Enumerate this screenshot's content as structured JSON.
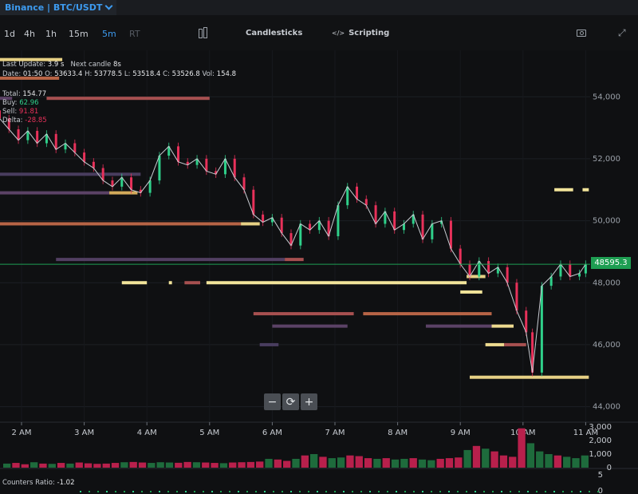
{
  "header": {
    "title": "Binance | BTC/USDT"
  },
  "toolbar": {
    "timeframes": [
      "1d",
      "4h",
      "1h",
      "15m",
      "5m",
      "RT"
    ],
    "active_timeframe": "5m",
    "candlesticks_label": "Candlesticks",
    "scripting_label": "Scripting",
    "scripting_glyph": "</>"
  },
  "info": {
    "last_update_label": "Last Update:",
    "last_update_value": "3.9 s",
    "next_candle_label": "Next candle",
    "next_candle_value": "8s",
    "date_label": "Date:",
    "date_value": "01:50",
    "o_label": "O:",
    "o_value": "53633.4",
    "h_label": "H:",
    "h_value": "53778.5",
    "l_label": "L:",
    "l_value": "53518.4",
    "c_label": "C:",
    "c_value": "53526.8",
    "vol_label": "Vol:",
    "vol_value": "154.8",
    "total_label": "Total:",
    "total_value": "154.77",
    "buy_label": "Buy:",
    "buy_value": "62.96",
    "sell_label": "Sell:",
    "sell_value": "91.81",
    "delta_label": "Delta:",
    "delta_value": "-28.85"
  },
  "zoom": {
    "minus": "−",
    "reset": "⟳",
    "plus": "+"
  },
  "counters": {
    "label": "Counters Ratio:",
    "value": "-1.02"
  },
  "current_price": "48595.3",
  "colors": {
    "accent": "#3d9bf0",
    "up": "#2fd08a",
    "down": "#e8315a",
    "price_line": "#1e9e52",
    "liquidity_strong": "#f2e49a",
    "liquidity_weak": "#23344f"
  },
  "chart_data": {
    "type": "line",
    "x_unit": "hours",
    "x": [
      1.5,
      1.65,
      1.8,
      1.95,
      2.1,
      2.25,
      2.4,
      2.55,
      2.7,
      2.85,
      3.0,
      3.15,
      3.3,
      3.45,
      3.6,
      3.75,
      3.9,
      4.05,
      4.2,
      4.35,
      4.5,
      4.65,
      4.8,
      4.95,
      5.1,
      5.25,
      5.4,
      5.55,
      5.7,
      5.85,
      6.0,
      6.15,
      6.3,
      6.45,
      6.6,
      6.75,
      6.9,
      7.05,
      7.2,
      7.35,
      7.5,
      7.65,
      7.8,
      7.95,
      8.1,
      8.25,
      8.4,
      8.55,
      8.7,
      8.85,
      9.0,
      9.15,
      9.3,
      9.45,
      9.6,
      9.75,
      9.9,
      10.05,
      10.15,
      10.3,
      10.45,
      10.6,
      10.75,
      10.9,
      11.0
    ],
    "values": [
      53560,
      53300,
      52950,
      52600,
      52900,
      52500,
      52800,
      52300,
      52500,
      52200,
      51900,
      51700,
      51300,
      51100,
      51400,
      51000,
      50900,
      51300,
      52100,
      52400,
      51900,
      51800,
      52000,
      51600,
      51500,
      52000,
      51400,
      51000,
      50200,
      49950,
      50100,
      49600,
      49200,
      49900,
      49700,
      50000,
      49500,
      50500,
      51100,
      50700,
      50500,
      49900,
      50300,
      49700,
      49900,
      50200,
      49400,
      49900,
      50000,
      49100,
      48600,
      48200,
      48700,
      48300,
      48500,
      48000,
      47100,
      46400,
      45100,
      47900,
      48200,
      48600,
      48200,
      48300,
      48600
    ],
    "ylim": [
      43500,
      55500
    ],
    "y_ticks": [
      44000,
      46000,
      48000,
      50000,
      52000,
      54000
    ],
    "y_tick_labels": [
      "44,000",
      "46,000",
      "48,000",
      "50,000",
      "52,000",
      "54,000"
    ],
    "x_ticks": [
      2,
      3,
      4,
      5,
      6,
      7,
      8,
      9,
      10,
      11
    ],
    "x_tick_labels": [
      "2 AM",
      "3 AM",
      "4 AM",
      "5 AM",
      "6 AM",
      "7 AM",
      "8 AM",
      "9 AM",
      "10 AM",
      "11 AM"
    ],
    "volume": {
      "ylim": [
        0,
        3000
      ],
      "y_ticks": [
        0,
        1000,
        2000,
        3000
      ],
      "y_tick_labels": [
        "0",
        "1,000",
        "2,000",
        "3,000"
      ],
      "values": [
        300,
        350,
        250,
        400,
        300,
        280,
        350,
        300,
        380,
        320,
        280,
        300,
        350,
        400,
        420,
        380,
        350,
        400,
        380,
        360,
        420,
        400,
        380,
        350,
        330,
        380,
        400,
        420,
        450,
        650,
        600,
        500,
        650,
        900,
        1000,
        800,
        700,
        750,
        900,
        850,
        700,
        650,
        700,
        600,
        650,
        700,
        600,
        550,
        650,
        700,
        750,
        1300,
        1600,
        1400,
        1200,
        900,
        800,
        2900,
        1800,
        1200,
        1000,
        900,
        800,
        700,
        900
      ],
      "up": [
        1,
        0,
        0,
        1,
        0,
        1,
        0,
        1,
        0,
        0,
        0,
        0,
        0,
        1,
        0,
        0,
        1,
        1,
        1,
        0,
        0,
        1,
        0,
        0,
        1,
        0,
        0,
        0,
        0,
        1,
        0,
        0,
        1,
        0,
        1,
        0,
        1,
        1,
        0,
        0,
        0,
        1,
        0,
        1,
        1,
        0,
        1,
        1,
        0,
        0,
        0,
        1,
        0,
        1,
        0,
        0,
        0,
        0,
        1,
        1,
        1,
        0,
        1,
        1,
        1
      ]
    },
    "counters": {
      "ylim": [
        0,
        5
      ],
      "y_ticks": [
        0,
        5
      ],
      "y_tick_labels": [
        "0",
        "5"
      ]
    },
    "current_price": 48595.3,
    "order_book_levels": [
      {
        "price": 55200,
        "start": 1.5,
        "end": 2.65,
        "strength": 0.9
      },
      {
        "price": 54600,
        "start": 1.5,
        "end": 2.6,
        "strength": 0.6
      },
      {
        "price": 53950,
        "start": 2.4,
        "end": 5.0,
        "strength": 0.5
      },
      {
        "price": 53950,
        "start": 1.5,
        "end": 1.85,
        "strength": 0.3
      },
      {
        "price": 51500,
        "start": 1.5,
        "end": 3.9,
        "strength": 0.2
      },
      {
        "price": 50900,
        "start": 1.5,
        "end": 3.4,
        "strength": 0.3
      },
      {
        "price": 50900,
        "start": 3.4,
        "end": 3.85,
        "strength": 0.7
      },
      {
        "price": 49900,
        "start": 1.5,
        "end": 5.5,
        "strength": 0.6
      },
      {
        "price": 49900,
        "start": 5.5,
        "end": 5.8,
        "strength": 0.9
      },
      {
        "price": 48750,
        "start": 2.55,
        "end": 6.2,
        "strength": 0.25
      },
      {
        "price": 48750,
        "start": 6.2,
        "end": 6.5,
        "strength": 0.5
      },
      {
        "price": 48000,
        "start": 3.6,
        "end": 4.0,
        "strength": 1.0
      },
      {
        "price": 48000,
        "start": 4.35,
        "end": 4.4,
        "strength": 1.0
      },
      {
        "price": 48000,
        "start": 4.6,
        "end": 4.85,
        "strength": 0.5
      },
      {
        "price": 48000,
        "start": 4.95,
        "end": 9.1,
        "strength": 1.0
      },
      {
        "price": 47000,
        "start": 5.7,
        "end": 7.3,
        "strength": 0.5
      },
      {
        "price": 47000,
        "start": 7.45,
        "end": 9.5,
        "strength": 0.6
      },
      {
        "price": 46600,
        "start": 6.0,
        "end": 7.2,
        "strength": 0.3
      },
      {
        "price": 46600,
        "start": 8.45,
        "end": 9.5,
        "strength": 0.3
      },
      {
        "price": 46600,
        "start": 9.5,
        "end": 9.85,
        "strength": 0.95
      },
      {
        "price": 46000,
        "start": 5.8,
        "end": 6.1,
        "strength": 0.2
      },
      {
        "price": 46000,
        "start": 9.4,
        "end": 9.7,
        "strength": 0.95
      },
      {
        "price": 46000,
        "start": 9.7,
        "end": 10.05,
        "strength": 0.5
      },
      {
        "price": 44950,
        "start": 9.15,
        "end": 11.05,
        "strength": 0.9
      },
      {
        "price": 51000,
        "start": 10.5,
        "end": 10.8,
        "strength": 1.0
      },
      {
        "price": 51000,
        "start": 10.95,
        "end": 11.05,
        "strength": 1.0
      },
      {
        "price": 48200,
        "start": 9.1,
        "end": 9.4,
        "strength": 0.9
      },
      {
        "price": 47700,
        "start": 9.0,
        "end": 9.35,
        "strength": 1.0
      }
    ],
    "grid": true
  }
}
